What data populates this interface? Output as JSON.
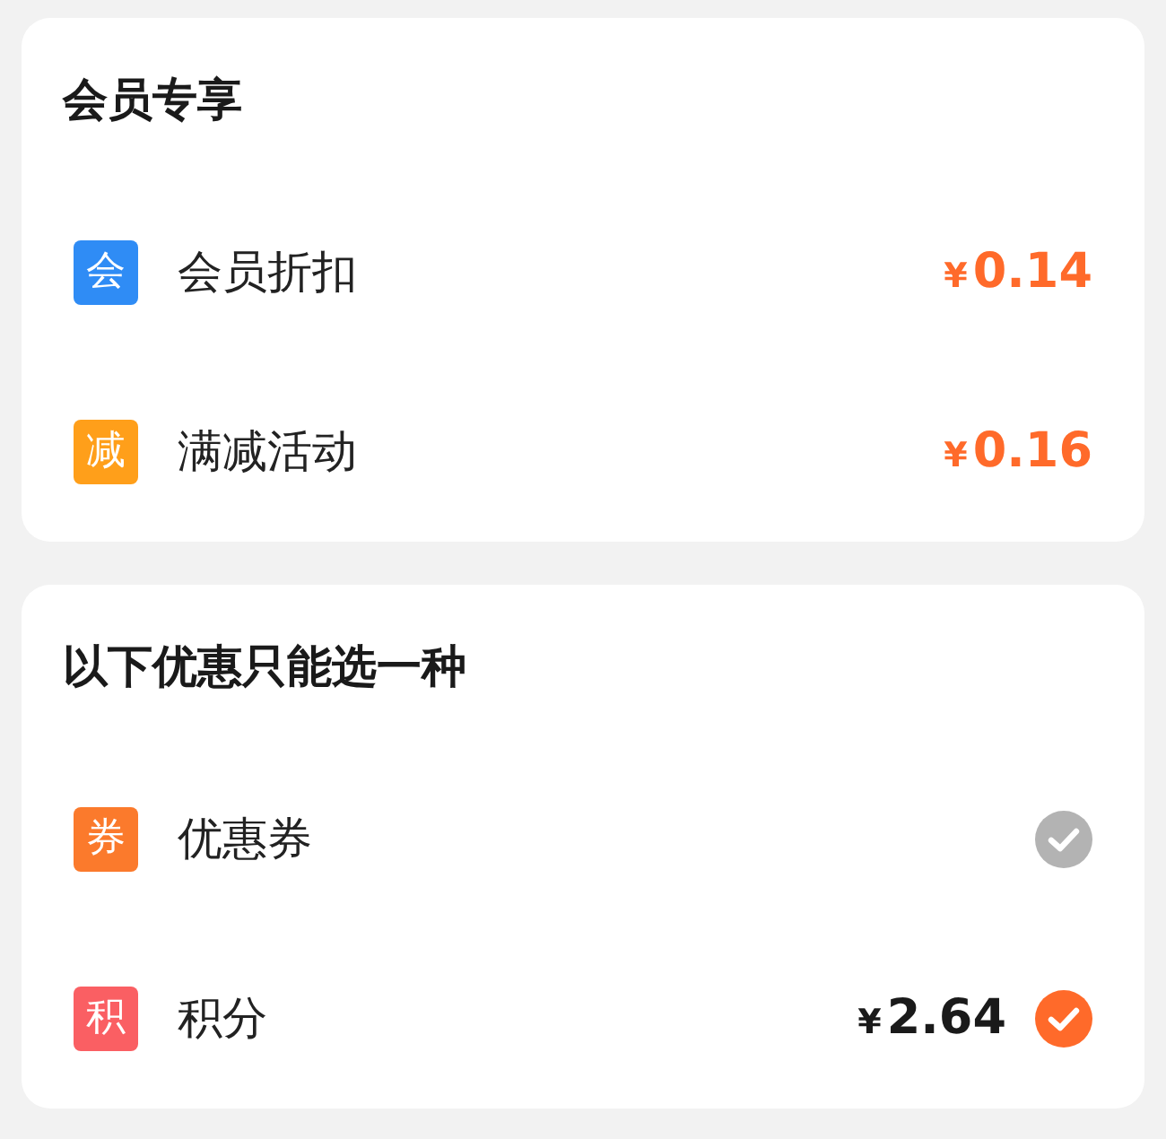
{
  "sections": [
    {
      "title": "会员专享",
      "kind": "discount",
      "items": [
        {
          "badge": "会",
          "color": "#2f8cf5",
          "label": "会员折扣",
          "currency": "¥",
          "amount": "0.14"
        },
        {
          "badge": "减",
          "color": "#ff9f1a",
          "label": "满减活动",
          "currency": "¥",
          "amount": "0.16"
        }
      ]
    },
    {
      "title": "以下优惠只能选一种",
      "kind": "choice",
      "items": [
        {
          "badge": "券",
          "color": "#fb7a2c",
          "label": "优惠券",
          "selected": false
        },
        {
          "badge": "积",
          "color": "#fa5f63",
          "label": "积分",
          "currency": "¥",
          "amount": "2.64",
          "selected": true
        }
      ]
    }
  ]
}
